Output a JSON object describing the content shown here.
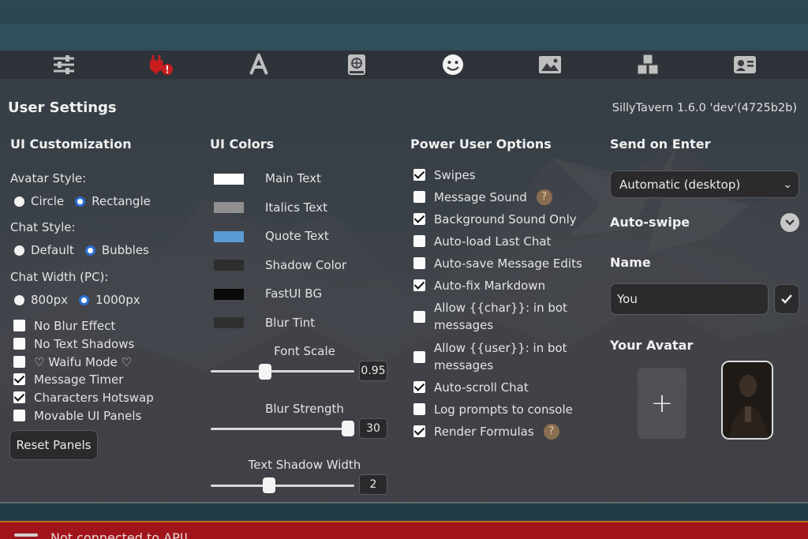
{
  "colors": {
    "accent": "#2a6fd6",
    "panel": "#3a3c42",
    "alert": "#a0141a",
    "quote": "#5b9bd5"
  },
  "nav": {
    "icons": [
      "sliders-icon",
      "plug-warning-icon",
      "font-icon",
      "world-book-icon",
      "smile-icon",
      "image-icon",
      "extensions-cubes-icon",
      "persona-card-icon"
    ]
  },
  "header": {
    "title": "User Settings",
    "version": "SillyTavern 1.6.0 'dev'(4725b2b)"
  },
  "ui_customization": {
    "title": "UI Customization",
    "avatar_style": {
      "label": "Avatar Style:",
      "options": [
        "Circle",
        "Rectangle"
      ],
      "selected": "Rectangle"
    },
    "chat_style": {
      "label": "Chat Style:",
      "options": [
        "Default",
        "Bubbles"
      ],
      "selected": "Bubbles"
    },
    "chat_width": {
      "label": "Chat Width (PC):",
      "options": [
        "800px",
        "1000px"
      ],
      "selected": "1000px"
    },
    "checkboxes": [
      {
        "label": "No Blur Effect",
        "checked": false
      },
      {
        "label": "No Text Shadows",
        "checked": false
      },
      {
        "label": "♡ Waifu Mode ♡",
        "checked": false
      },
      {
        "label": "Message Timer",
        "checked": true
      },
      {
        "label": "Characters Hotswap",
        "checked": true
      },
      {
        "label": "Movable UI Panels",
        "checked": false
      }
    ],
    "reset_button": "Reset Panels"
  },
  "ui_colors": {
    "title": "UI Colors",
    "items": [
      {
        "label": "Main Text",
        "color": "#ffffff"
      },
      {
        "label": "Italics Text",
        "color": "#8f8f8f"
      },
      {
        "label": "Quote Text",
        "color": "#5b9bd5"
      },
      {
        "label": "Shadow Color",
        "color": "#2e2e2e"
      },
      {
        "label": "FastUI BG",
        "color": "#0a0a0a"
      },
      {
        "label": "Blur Tint",
        "color": "#2f2f31"
      }
    ],
    "sliders": [
      {
        "label": "Font Scale",
        "value": "0.95",
        "fraction": 0.37
      },
      {
        "label": "Blur Strength",
        "value": "30",
        "fraction": 1.0
      },
      {
        "label": "Text Shadow Width",
        "value": "2",
        "fraction": 0.4
      }
    ]
  },
  "power_user": {
    "title": "Power User Options",
    "options": [
      {
        "label": "Swipes",
        "checked": true
      },
      {
        "label": "Message Sound",
        "checked": false,
        "help": true
      },
      {
        "label": "Background Sound Only",
        "checked": true
      },
      {
        "label": "Auto-load Last Chat",
        "checked": false
      },
      {
        "label": "Auto-save Message Edits",
        "checked": false
      },
      {
        "label": "Auto-fix Markdown",
        "checked": true
      },
      {
        "label": "Allow {{char}}: in bot messages",
        "checked": false
      },
      {
        "label": "Allow {{user}}: in bot messages",
        "checked": false
      },
      {
        "label": "Auto-scroll Chat",
        "checked": true
      },
      {
        "label": "Log prompts to console",
        "checked": false
      },
      {
        "label": "Render Formulas",
        "checked": true,
        "help": true
      }
    ],
    "help_glyph": "?"
  },
  "send_on_enter": {
    "title": "Send on Enter",
    "selected": "Automatic (desktop)"
  },
  "auto_swipe": {
    "title": "Auto-swipe"
  },
  "name": {
    "title": "Name",
    "value": "You"
  },
  "avatar": {
    "title": "Your Avatar",
    "add_glyph": "+"
  },
  "bottom": {
    "message": "Not connected to API!"
  }
}
